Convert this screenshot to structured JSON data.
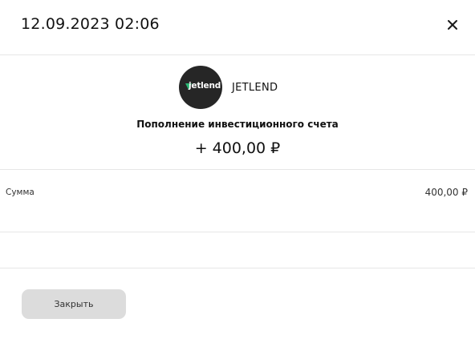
{
  "header": {
    "title": "12.09.2023 02:06",
    "close_icon": "close-icon"
  },
  "merchant": {
    "logo_text": "jetlend",
    "logo_icon": "leaf-icon",
    "logo_colors": {
      "background": "#262626",
      "accent": "#2bb673",
      "text": "#ffffff"
    },
    "name": "JETLEND"
  },
  "operation": {
    "title": "Пополнение инвестиционного счета",
    "amount": "+ 400,00 ₽"
  },
  "details": [
    {
      "label": "Сумма",
      "value": "400,00 ₽"
    }
  ],
  "footer": {
    "close_button_label": "Закрыть"
  },
  "colors": {
    "button_bg": "#dcdcdc",
    "divider": "#e6e6e6"
  }
}
